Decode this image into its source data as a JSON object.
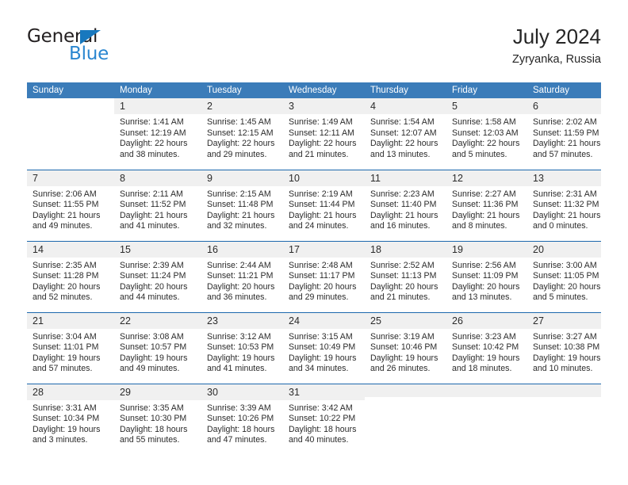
{
  "brand": {
    "name_dark": "General",
    "name_blue": "Blue",
    "triangle_color": "#1878be",
    "blue_color": "#2a86d0"
  },
  "header": {
    "title": "July 2024",
    "subtitle": "Zyryanka, Russia"
  },
  "theme": {
    "header_blue": "#3b7cb9",
    "rule_blue": "#1c68ad",
    "daynum_band": "#f0f0f0"
  },
  "weekdays": [
    "Sunday",
    "Monday",
    "Tuesday",
    "Wednesday",
    "Thursday",
    "Friday",
    "Saturday"
  ],
  "weeks": [
    [
      {
        "blank": true
      },
      {
        "day": "1",
        "sunrise": "Sunrise: 1:41 AM",
        "sunset": "Sunset: 12:19 AM",
        "daylight1": "Daylight: 22 hours",
        "daylight2": "and 38 minutes."
      },
      {
        "day": "2",
        "sunrise": "Sunrise: 1:45 AM",
        "sunset": "Sunset: 12:15 AM",
        "daylight1": "Daylight: 22 hours",
        "daylight2": "and 29 minutes."
      },
      {
        "day": "3",
        "sunrise": "Sunrise: 1:49 AM",
        "sunset": "Sunset: 12:11 AM",
        "daylight1": "Daylight: 22 hours",
        "daylight2": "and 21 minutes."
      },
      {
        "day": "4",
        "sunrise": "Sunrise: 1:54 AM",
        "sunset": "Sunset: 12:07 AM",
        "daylight1": "Daylight: 22 hours",
        "daylight2": "and 13 minutes."
      },
      {
        "day": "5",
        "sunrise": "Sunrise: 1:58 AM",
        "sunset": "Sunset: 12:03 AM",
        "daylight1": "Daylight: 22 hours",
        "daylight2": "and 5 minutes."
      },
      {
        "day": "6",
        "sunrise": "Sunrise: 2:02 AM",
        "sunset": "Sunset: 11:59 PM",
        "daylight1": "Daylight: 21 hours",
        "daylight2": "and 57 minutes."
      }
    ],
    [
      {
        "day": "7",
        "sunrise": "Sunrise: 2:06 AM",
        "sunset": "Sunset: 11:55 PM",
        "daylight1": "Daylight: 21 hours",
        "daylight2": "and 49 minutes."
      },
      {
        "day": "8",
        "sunrise": "Sunrise: 2:11 AM",
        "sunset": "Sunset: 11:52 PM",
        "daylight1": "Daylight: 21 hours",
        "daylight2": "and 41 minutes."
      },
      {
        "day": "9",
        "sunrise": "Sunrise: 2:15 AM",
        "sunset": "Sunset: 11:48 PM",
        "daylight1": "Daylight: 21 hours",
        "daylight2": "and 32 minutes."
      },
      {
        "day": "10",
        "sunrise": "Sunrise: 2:19 AM",
        "sunset": "Sunset: 11:44 PM",
        "daylight1": "Daylight: 21 hours",
        "daylight2": "and 24 minutes."
      },
      {
        "day": "11",
        "sunrise": "Sunrise: 2:23 AM",
        "sunset": "Sunset: 11:40 PM",
        "daylight1": "Daylight: 21 hours",
        "daylight2": "and 16 minutes."
      },
      {
        "day": "12",
        "sunrise": "Sunrise: 2:27 AM",
        "sunset": "Sunset: 11:36 PM",
        "daylight1": "Daylight: 21 hours",
        "daylight2": "and 8 minutes."
      },
      {
        "day": "13",
        "sunrise": "Sunrise: 2:31 AM",
        "sunset": "Sunset: 11:32 PM",
        "daylight1": "Daylight: 21 hours",
        "daylight2": "and 0 minutes."
      }
    ],
    [
      {
        "day": "14",
        "sunrise": "Sunrise: 2:35 AM",
        "sunset": "Sunset: 11:28 PM",
        "daylight1": "Daylight: 20 hours",
        "daylight2": "and 52 minutes."
      },
      {
        "day": "15",
        "sunrise": "Sunrise: 2:39 AM",
        "sunset": "Sunset: 11:24 PM",
        "daylight1": "Daylight: 20 hours",
        "daylight2": "and 44 minutes."
      },
      {
        "day": "16",
        "sunrise": "Sunrise: 2:44 AM",
        "sunset": "Sunset: 11:21 PM",
        "daylight1": "Daylight: 20 hours",
        "daylight2": "and 36 minutes."
      },
      {
        "day": "17",
        "sunrise": "Sunrise: 2:48 AM",
        "sunset": "Sunset: 11:17 PM",
        "daylight1": "Daylight: 20 hours",
        "daylight2": "and 29 minutes."
      },
      {
        "day": "18",
        "sunrise": "Sunrise: 2:52 AM",
        "sunset": "Sunset: 11:13 PM",
        "daylight1": "Daylight: 20 hours",
        "daylight2": "and 21 minutes."
      },
      {
        "day": "19",
        "sunrise": "Sunrise: 2:56 AM",
        "sunset": "Sunset: 11:09 PM",
        "daylight1": "Daylight: 20 hours",
        "daylight2": "and 13 minutes."
      },
      {
        "day": "20",
        "sunrise": "Sunrise: 3:00 AM",
        "sunset": "Sunset: 11:05 PM",
        "daylight1": "Daylight: 20 hours",
        "daylight2": "and 5 minutes."
      }
    ],
    [
      {
        "day": "21",
        "sunrise": "Sunrise: 3:04 AM",
        "sunset": "Sunset: 11:01 PM",
        "daylight1": "Daylight: 19 hours",
        "daylight2": "and 57 minutes."
      },
      {
        "day": "22",
        "sunrise": "Sunrise: 3:08 AM",
        "sunset": "Sunset: 10:57 PM",
        "daylight1": "Daylight: 19 hours",
        "daylight2": "and 49 minutes."
      },
      {
        "day": "23",
        "sunrise": "Sunrise: 3:12 AM",
        "sunset": "Sunset: 10:53 PM",
        "daylight1": "Daylight: 19 hours",
        "daylight2": "and 41 minutes."
      },
      {
        "day": "24",
        "sunrise": "Sunrise: 3:15 AM",
        "sunset": "Sunset: 10:49 PM",
        "daylight1": "Daylight: 19 hours",
        "daylight2": "and 34 minutes."
      },
      {
        "day": "25",
        "sunrise": "Sunrise: 3:19 AM",
        "sunset": "Sunset: 10:46 PM",
        "daylight1": "Daylight: 19 hours",
        "daylight2": "and 26 minutes."
      },
      {
        "day": "26",
        "sunrise": "Sunrise: 3:23 AM",
        "sunset": "Sunset: 10:42 PM",
        "daylight1": "Daylight: 19 hours",
        "daylight2": "and 18 minutes."
      },
      {
        "day": "27",
        "sunrise": "Sunrise: 3:27 AM",
        "sunset": "Sunset: 10:38 PM",
        "daylight1": "Daylight: 19 hours",
        "daylight2": "and 10 minutes."
      }
    ],
    [
      {
        "day": "28",
        "sunrise": "Sunrise: 3:31 AM",
        "sunset": "Sunset: 10:34 PM",
        "daylight1": "Daylight: 19 hours",
        "daylight2": "and 3 minutes."
      },
      {
        "day": "29",
        "sunrise": "Sunrise: 3:35 AM",
        "sunset": "Sunset: 10:30 PM",
        "daylight1": "Daylight: 18 hours",
        "daylight2": "and 55 minutes."
      },
      {
        "day": "30",
        "sunrise": "Sunrise: 3:39 AM",
        "sunset": "Sunset: 10:26 PM",
        "daylight1": "Daylight: 18 hours",
        "daylight2": "and 47 minutes."
      },
      {
        "day": "31",
        "sunrise": "Sunrise: 3:42 AM",
        "sunset": "Sunset: 10:22 PM",
        "daylight1": "Daylight: 18 hours",
        "daylight2": "and 40 minutes."
      },
      {
        "empty": true
      },
      {
        "empty": true
      },
      {
        "empty": true
      }
    ]
  ]
}
